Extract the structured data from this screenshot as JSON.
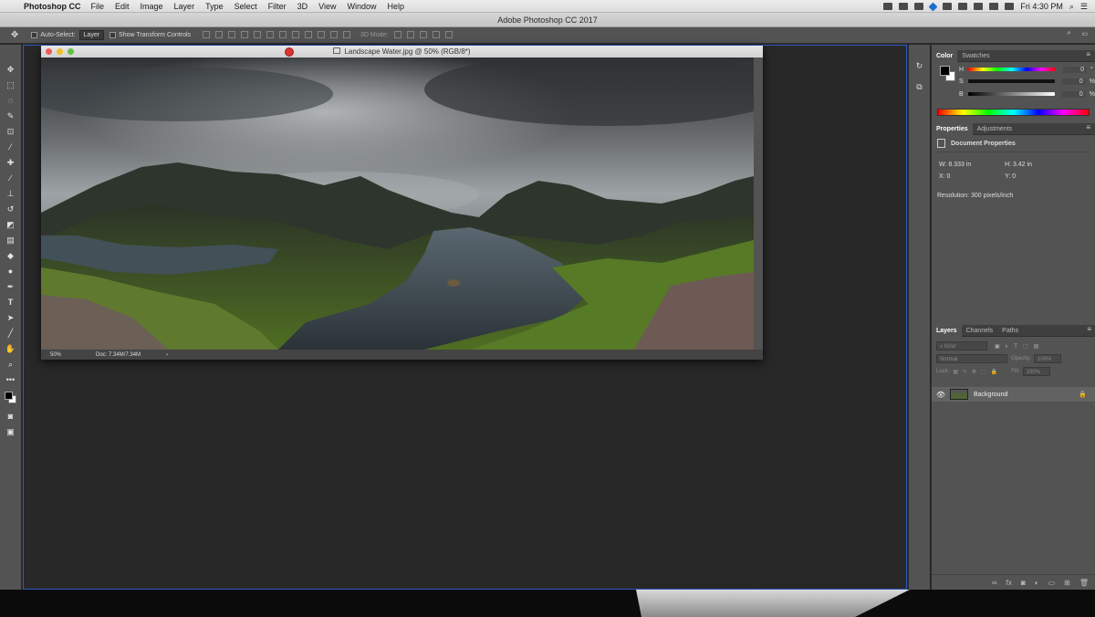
{
  "menubar": {
    "app_name": "Photoshop CC",
    "items": [
      "File",
      "Edit",
      "Image",
      "Layer",
      "Type",
      "Select",
      "Filter",
      "3D",
      "View",
      "Window",
      "Help"
    ],
    "clock": "Fri 4:30 PM"
  },
  "window": {
    "title": "Adobe Photoshop CC 2017"
  },
  "options": {
    "auto_select": "Auto-Select:",
    "layer_dropdown": "Layer",
    "show_transform": "Show Transform Controls",
    "mode_3d": "3D Mode:"
  },
  "document": {
    "title": "Landscape Water.jpg @ 50% (RGB/8*)",
    "zoom": "50%",
    "doc_size": "Doc: 7.34M/7.34M"
  },
  "color_panel": {
    "tabs": [
      "Color",
      "Swatches"
    ],
    "h_label": "H",
    "h_value": "0",
    "h_unit": "°",
    "s_label": "S",
    "s_value": "0",
    "s_unit": "%",
    "b_label": "B",
    "b_value": "0",
    "b_unit": "%"
  },
  "properties_panel": {
    "tabs": [
      "Properties",
      "Adjustments"
    ],
    "heading": "Document Properties",
    "w": "W: 8.333 in",
    "h": "H: 3.42 in",
    "x": "X: 0",
    "y": "Y: 0",
    "resolution": "Resolution: 300 pixels/inch"
  },
  "layers_panel": {
    "tabs": [
      "Layers",
      "Channels",
      "Paths"
    ],
    "kind": "Kind",
    "blend_mode": "Normal",
    "opacity_label": "Opacity:",
    "opacity_value": "100%",
    "lock_label": "Lock:",
    "fill_label": "Fill:",
    "fill_value": "100%",
    "layer_name": "Background"
  }
}
